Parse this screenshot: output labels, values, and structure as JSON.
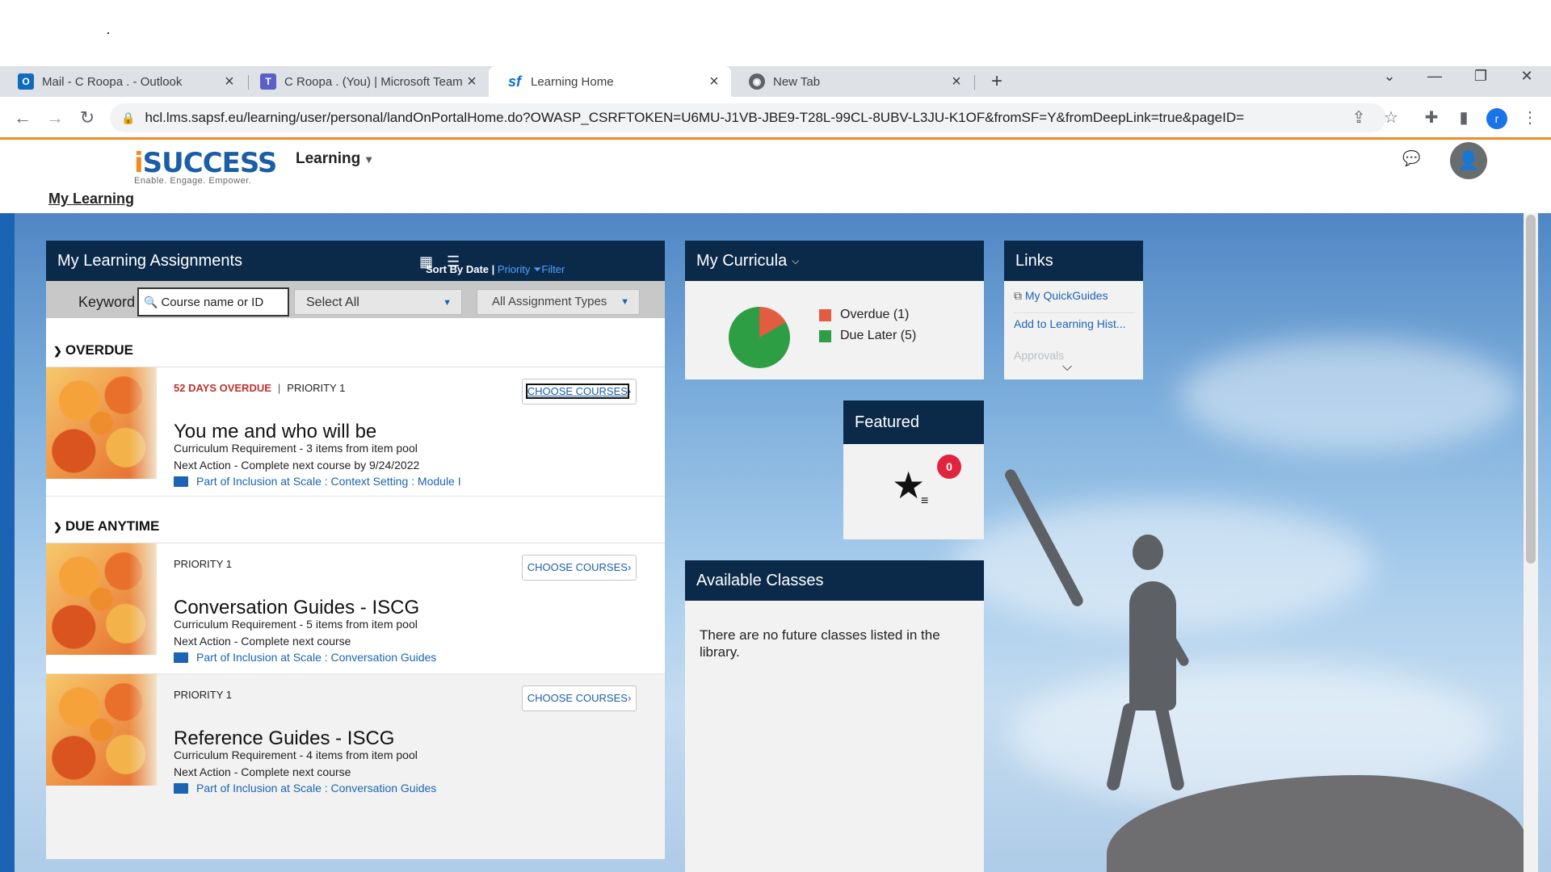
{
  "browser": {
    "tabs": [
      {
        "label": "Mail - C Roopa . - Outlook",
        "icon": "outlook-icon",
        "active": false
      },
      {
        "label": "C Roopa . (You) | Microsoft Teams",
        "icon": "teams-icon",
        "active": false
      },
      {
        "label": "Learning Home",
        "icon": "sf-icon",
        "active": true
      },
      {
        "label": "New Tab",
        "icon": "chrome-icon",
        "active": false
      }
    ],
    "url": "hcl.lms.sapsf.eu/learning/user/personal/landOnPortalHome.do?OWASP_CSRFTOKEN=U6MU-J1VB-JBE9-T28L-99CL-8UBV-L3JU-K1OF&fromSF=Y&fromDeepLink=true&pageID=",
    "profile_initial": "r"
  },
  "header": {
    "logo_text_i": "i",
    "logo_text_rest": "SUCCESS",
    "logo_tagline": "Enable. Engage. Empower.",
    "module_menu": "Learning",
    "breadcrumb": "My Learning"
  },
  "assignments": {
    "title": "My Learning Assignments",
    "sort_label": "Sort By Date |",
    "sort_priority": "Priority",
    "filter_label": "Filter",
    "keyword_label": "Keyword",
    "keyword_placeholder": "Course name or ID",
    "select_all": "Select All",
    "assignment_types": "All Assignment Types",
    "sections": {
      "overdue": "OVERDUE",
      "due_anytime": "DUE ANYTIME"
    },
    "items": [
      {
        "status": "52 DAYS OVERDUE",
        "priority": "PRIORITY 1",
        "button": "CHOOSE COURSES",
        "title": "You me and who will be",
        "requirement": "Curriculum Requirement - 3 items from item pool",
        "next_action": "Next Action - Complete next course by 9/24/2022",
        "part_of": "Part of Inclusion at Scale : Context Setting : Module I"
      },
      {
        "priority": "PRIORITY 1",
        "button": "CHOOSE COURSES",
        "title": "Conversation Guides - ISCG",
        "requirement": "Curriculum Requirement - 5 items from item pool",
        "next_action": "Next Action - Complete next course",
        "part_of": "Part of Inclusion at Scale : Conversation Guides"
      },
      {
        "priority": "PRIORITY 1",
        "button": "CHOOSE COURSES",
        "title": "Reference Guides - ISCG",
        "requirement": "Curriculum Requirement - 4 items from item pool",
        "next_action": "Next Action - Complete next course",
        "part_of": "Part of Inclusion at Scale : Conversation Guides"
      }
    ]
  },
  "curricula": {
    "title": "My Curricula",
    "legend": [
      {
        "label": "Overdue (1)",
        "color": "#e25d40",
        "count": 1
      },
      {
        "label": "Due Later (5)",
        "color": "#2e9e45",
        "count": 5
      }
    ]
  },
  "links": {
    "title": "Links",
    "items": [
      "My QuickGuides",
      "Add to Learning Hist...",
      "Approvals"
    ]
  },
  "featured": {
    "title": "Featured",
    "count": "0"
  },
  "classes": {
    "title": "Available Classes",
    "message": "There are no future classes listed in the library."
  },
  "colors": {
    "accent": "#f08a24",
    "panel_header": "#0b2a4a",
    "link": "#1b64b3",
    "overdue": "#c0312c",
    "badge": "#e0243f"
  }
}
